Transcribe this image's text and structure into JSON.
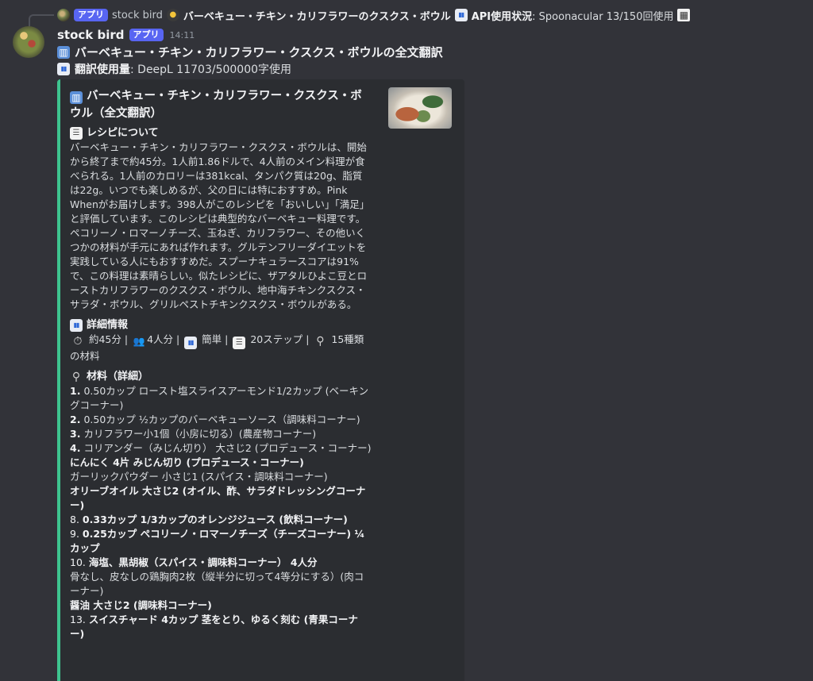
{
  "reply": {
    "badge": "アプリ",
    "author": "stock bird",
    "title": "バーベキュー・チキン・カリフラワーのクスクス・ボウル",
    "stats_label": "API使用状況",
    "stats_value": ": Spoonacular 13/150回使用"
  },
  "message": {
    "author": "stock bird",
    "badge": "アプリ",
    "timestamp": "14:11",
    "title": "バーベキュー・チキン・カリフラワー・クスクス・ボウルの全文翻訳",
    "usage_label": "翻訳使用量",
    "usage_value": ": DeepL 11703/500000字使用"
  },
  "embed": {
    "accent_color": "#3ec48f",
    "title": "バーベキュー・チキン・カリフラワー・クスクス・ボウル（全文翻訳）",
    "about_heading": "レシピについて",
    "about_text": "バーベキュー・チキン・カリフラワー・クスクス・ボウルは、開始から終了まで約45分。1人前1.86ドルで、4人前のメイン料理が食べられる。1人前のカロリーは381kcal、タンパク質は20g、脂質は22g。いつでも楽しめるが、父の日には特におすすめ。Pink Whenがお届けします。398人がこのレシピを「おいしい」「満足」と評価しています。このレシピは典型的なバーベキュー料理です。ペコリーノ・ロマーノチーズ、玉ねぎ、カリフラワー、その他いくつかの材料が手元にあれば作れます。グルテンフリーダイエットを実践している人にもおすすめだ。スプーナキュラースコアは91%で、この料理は素晴らしい。似たレシピに、ザアタルひよこ豆とローストカリフラワーのクスクス・ボウル、地中海チキンクスクス・サラダ・ボウル、グリルペストチキンクスクス・ボウルがある。",
    "details_heading": "詳細情報",
    "details": {
      "time": "約45分",
      "servings": "4人分",
      "difficulty": "簡単",
      "steps": "20ステップ",
      "ingredients": "15種類の材料",
      "sep": " | "
    },
    "ingredients_heading": "材料（詳細）",
    "ingredients": [
      {
        "num": "1.",
        "text": "0.50カップ ロースト塩スライスアーモンド1/2カップ (ベーキングコーナー)"
      },
      {
        "num": "2.",
        "text": "0.50カップ ½カップのバーベキューソース（調味料コーナー)"
      },
      {
        "num": "3.",
        "text": "カリフラワー小1個（小房に切る）(農産物コーナー)"
      },
      {
        "num": "4.",
        "text": "コリアンダー（みじん切り） 大さじ2 (プロデュース・コーナー)"
      },
      {
        "num": "",
        "text": "にんにく 4片 みじん切り (プロデュース・コーナー)",
        "bold": true
      },
      {
        "num": "",
        "text": "ガーリックパウダー 小さじ1 (スパイス・調味料コーナー)"
      },
      {
        "num": "",
        "text": "オリーブオイル 大さじ2 (オイル、酢、サラダドレッシングコーナー)",
        "bold": true
      },
      {
        "num": "8.",
        "text": "0.33カップ 1/3カップのオレンジジュース (飲料コーナー)",
        "bold": true,
        "plain_num": true
      },
      {
        "num": "9.",
        "text": "0.25カップ ペコリーノ・ロマーノチーズ（チーズコーナー) ¼カップ",
        "bold": true,
        "plain_num": true
      },
      {
        "num": "10.",
        "text": "海塩、黒胡椒（スパイス・調味料コーナー） 4人分",
        "bold": true,
        "plain_num": true
      },
      {
        "num": "",
        "text": "骨なし、皮なしの鶏胸肉2枚（縦半分に切って4等分にする）(肉コーナー)"
      },
      {
        "num": "",
        "text": "醤油 大さじ2 (調味料コーナー)",
        "bold": true
      },
      {
        "num": "13.",
        "text": "スイスチャード 4カップ 茎をとり、ゆるく刻む (青果コーナー)",
        "bold": true,
        "plain_num": true
      }
    ]
  },
  "colors": {
    "background": "#323339",
    "embed_bg": "#2b2d31",
    "badge": "#5865f2"
  }
}
